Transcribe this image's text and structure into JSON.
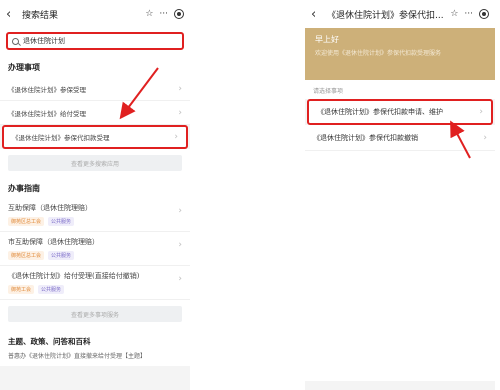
{
  "left": {
    "title": "搜索结果",
    "search_value": "退休住院计划",
    "section_affairs": "办理事项",
    "affairs": [
      "《退休住院计划》参保受理",
      "《退休住院计划》给付受理",
      "《退休住院计划》参保代扣款受理"
    ],
    "more_apps": "查看更多搜索应用",
    "section_guide": "办事指南",
    "guides": [
      {
        "title": "互助保障（退休住院理赔）",
        "tags": [
          "御苑区总工会",
          "公共服务"
        ]
      },
      {
        "title": "市互助保障（退休住院理赔）",
        "tags": [
          "御苑区总工会",
          "公共服务"
        ]
      },
      {
        "title": "《退休住院计划》给付受理(直接给付撤销)",
        "tags": [
          "御苑工会",
          "公共服务"
        ]
      }
    ],
    "more_services": "查看更多事项服务",
    "section_bottom": "主题、政策、问答和百科",
    "bottom_text": "普惠办《退休住院计划》直接撤来给付受理【主题】"
  },
  "right": {
    "title": "《退休住院计划》参保代扣...",
    "greeting": "早上好",
    "welcome": "欢迎使用《退休住院计划》参保代扣款受理服务",
    "prompt": "请选择事项",
    "items": [
      "《退休住院计划》参保代扣款申请、维护",
      "《退休住院计划》参保代扣款撤销"
    ]
  },
  "colors": {
    "highlight": "#e02020",
    "banner": "#cdb079"
  },
  "icons": [
    "back-icon",
    "star-icon",
    "more-icon",
    "target-icon",
    "search-icon",
    "chevron-right-icon"
  ]
}
